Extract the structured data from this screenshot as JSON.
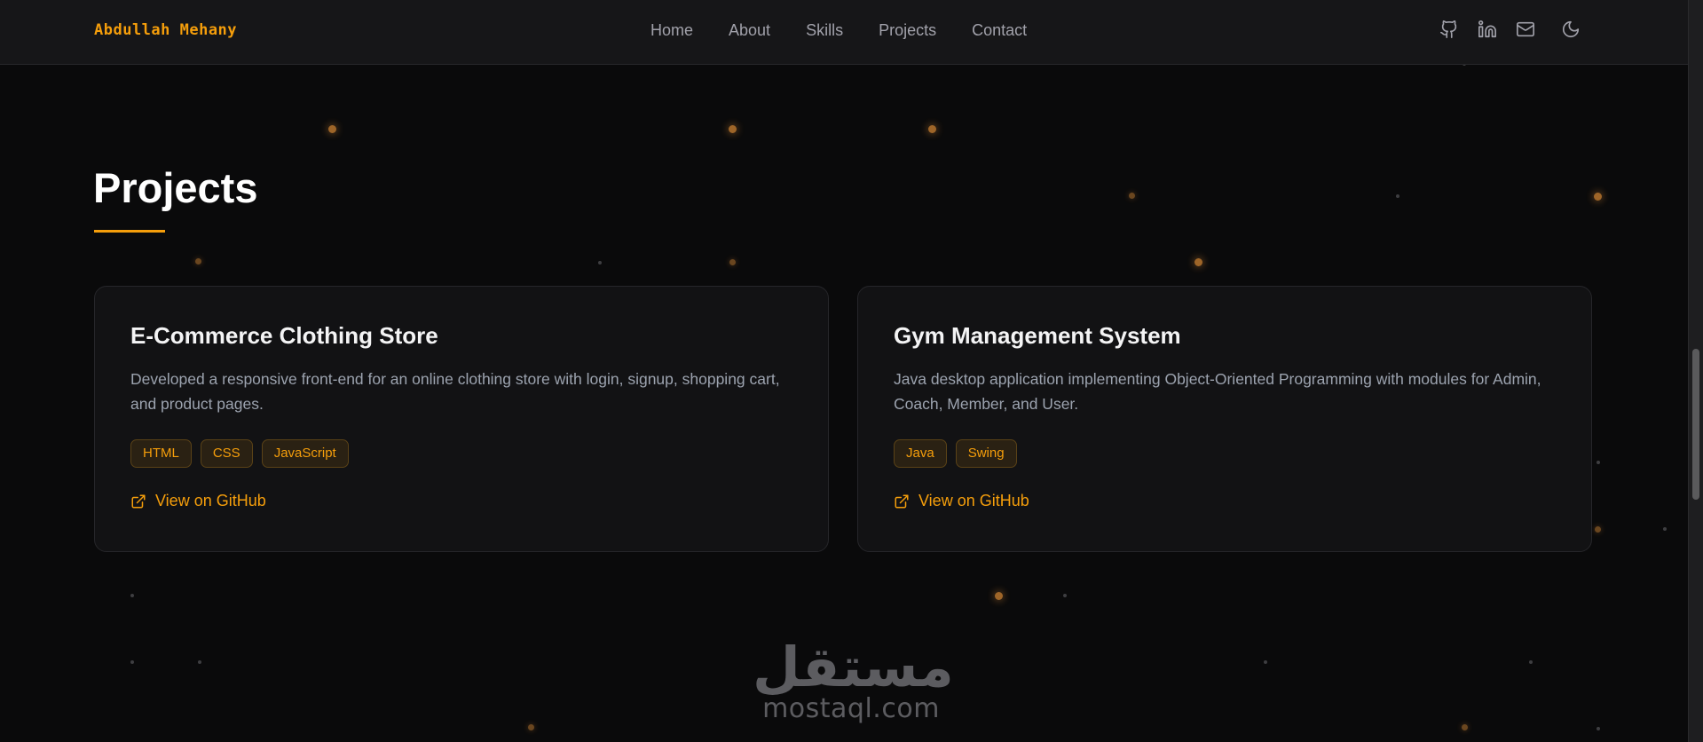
{
  "brand": {
    "name": "Abdullah Mehany"
  },
  "nav": {
    "links": [
      "Home",
      "About",
      "Skills",
      "Projects",
      "Contact"
    ],
    "icons": [
      "github-icon",
      "linkedin-icon",
      "mail-icon",
      "moon-icon"
    ]
  },
  "section": {
    "title": "Projects"
  },
  "projects": [
    {
      "title": "E-Commerce Clothing Store",
      "description": "Developed a responsive front-end for an online clothing store with login, signup, shopping cart, and product pages.",
      "tags": [
        "HTML",
        "CSS",
        "JavaScript"
      ],
      "link_label": "View on GitHub",
      "link_icon": "external-link-icon"
    },
    {
      "title": "Gym Management System",
      "description": "Java desktop application implementing Object-Oriented Programming with modules for Admin, Coach, Member, and User.",
      "tags": [
        "Java",
        "Swing"
      ],
      "link_label": "View on GitHub",
      "link_icon": "external-link-icon"
    }
  ],
  "watermark": {
    "arabic": "مستقل",
    "latin": "mostaql.com"
  },
  "colors": {
    "accent": "#f59e0b",
    "background": "#0a0a0b",
    "card": "#121214",
    "nav": "#161618"
  }
}
